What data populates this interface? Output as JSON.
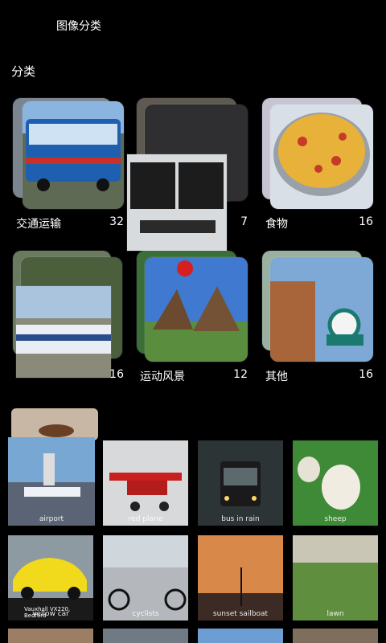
{
  "app": {
    "title": "图像分类"
  },
  "section": {
    "label": "分类"
  },
  "categories": [
    {
      "label": "交通运输",
      "count": "32"
    },
    {
      "label": "",
      "count": "7"
    },
    {
      "label": "食物",
      "count": "16"
    },
    {
      "label": "",
      "count": "16"
    },
    {
      "label": "运动风景",
      "count": "12"
    },
    {
      "label": "其他",
      "count": "16"
    }
  ],
  "grid": [
    {
      "alt": "airport"
    },
    {
      "alt": "red plane"
    },
    {
      "alt": "bus in rain"
    },
    {
      "alt": "sheep"
    },
    {
      "alt": "yellow car",
      "caption": "Vauxhall VX220, Bedford"
    },
    {
      "alt": "cyclists"
    },
    {
      "alt": "sunset sailboat"
    },
    {
      "alt": "lawn"
    }
  ],
  "colors": {
    "background": "#000000",
    "text": "#ffffff"
  }
}
